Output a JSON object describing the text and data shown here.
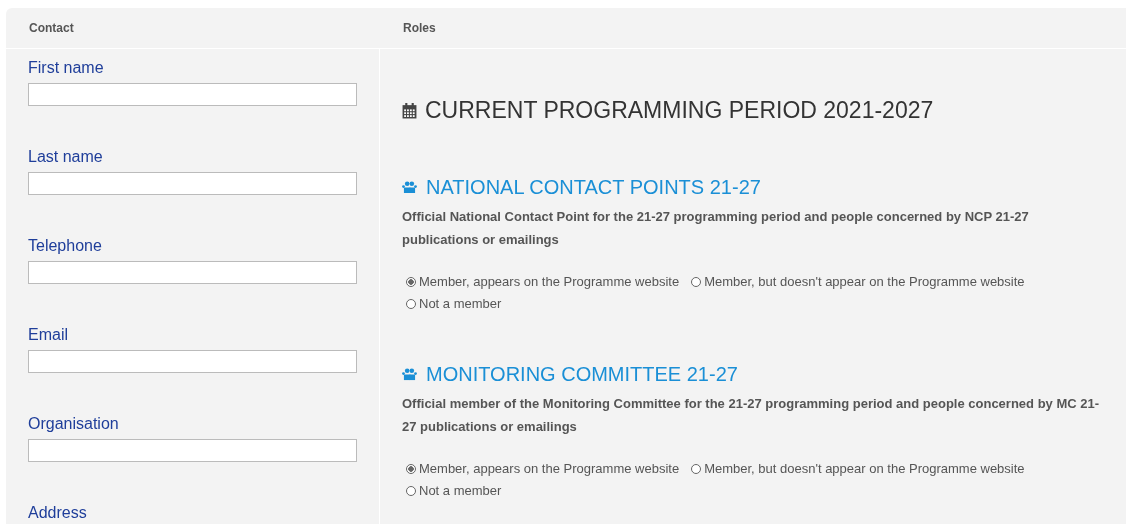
{
  "table": {
    "columns": [
      "Contact",
      "Roles"
    ]
  },
  "contact_fields": [
    {
      "label": "First name"
    },
    {
      "label": "Last name"
    },
    {
      "label": "Telephone"
    },
    {
      "label": "Email"
    },
    {
      "label": "Organisation"
    },
    {
      "label": "Address"
    }
  ],
  "period_title": "CURRENT PROGRAMMING PERIOD 2021-2027",
  "roles": [
    {
      "title": "NATIONAL CONTACT POINTS 21-27",
      "description": "Official National Contact Point for the 21-27 programming period and people concerned by NCP 21-27 publications or emailings",
      "options": [
        {
          "label": "Member, appears on the Programme website",
          "selected": true
        },
        {
          "label": "Member, but doesn't appear on the Programme website",
          "selected": false
        },
        {
          "label": "Not a member",
          "selected": false
        }
      ]
    },
    {
      "title": "MONITORING COMMITTEE 21-27",
      "description": "Official member of the Monitoring Committee for the 21-27 programming period and people concerned by MC 21-27 publications or emailings",
      "options": [
        {
          "label": "Member, appears on the Programme website",
          "selected": true
        },
        {
          "label": "Member, but doesn't appear on the Programme website",
          "selected": false
        },
        {
          "label": "Not a member",
          "selected": false
        }
      ]
    }
  ]
}
